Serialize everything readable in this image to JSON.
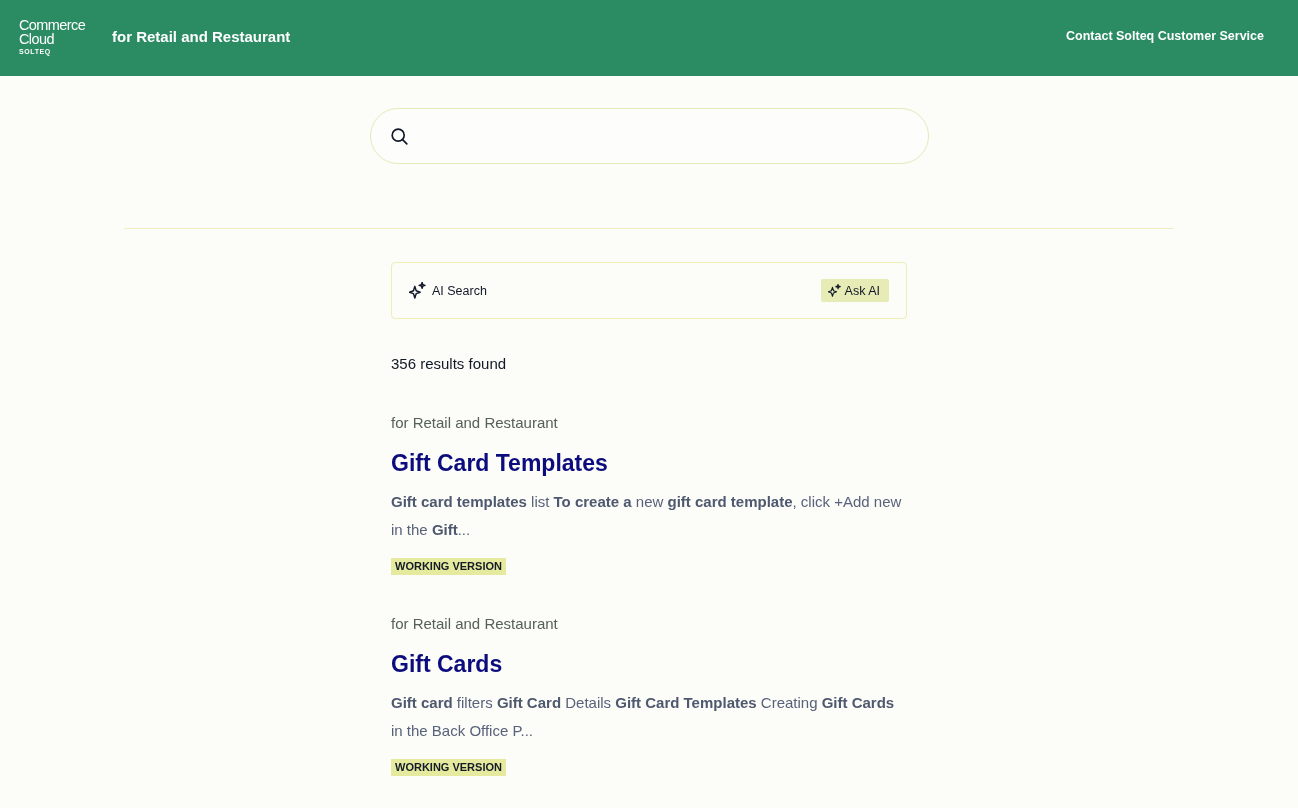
{
  "header": {
    "logo": {
      "title": "Commerce Cloud",
      "subtitle": "SOLTEQ"
    },
    "site_title": "for Retail and Restaurant",
    "contact_link": "Contact Solteq Customer Service"
  },
  "ai_bar": {
    "label": "AI Search",
    "button": "Ask AI"
  },
  "results_count": "356 results found",
  "results": [
    {
      "breadcrumb": "for Retail and Restaurant",
      "title": "Gift Card Templates",
      "snippet": "**Gift card templates** list **To create a** new **gift card template**, click +Add new in the **Gift**...",
      "badge": "WORKING VERSION"
    },
    {
      "breadcrumb": "for Retail and Restaurant",
      "title": "Gift Cards",
      "snippet": "**Gift card** filters **Gift Card** Details **Gift Card Templates** Creating **Gift Cards** in the Back Office P...",
      "badge": "WORKING VERSION"
    }
  ]
}
